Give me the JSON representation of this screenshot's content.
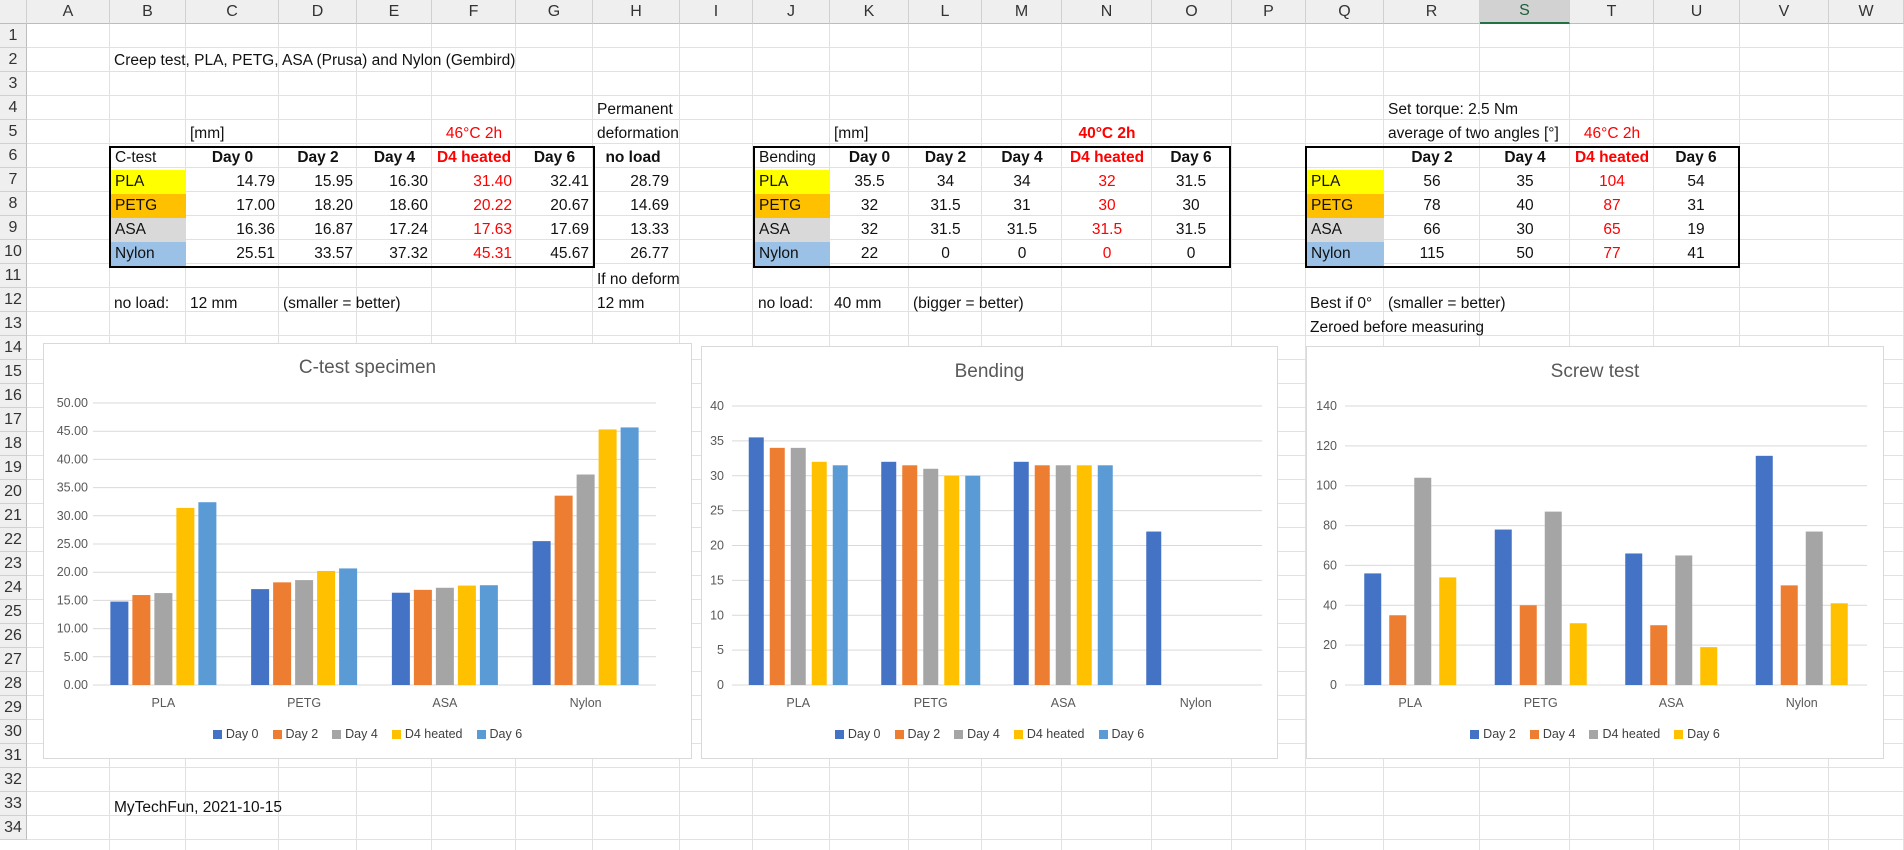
{
  "columns": [
    "A",
    "B",
    "C",
    "D",
    "E",
    "F",
    "G",
    "H",
    "I",
    "J",
    "K",
    "L",
    "M",
    "N",
    "O",
    "P",
    "Q",
    "R",
    "S",
    "T",
    "U",
    "V",
    "W"
  ],
  "rows": [
    "1",
    "2",
    "3",
    "4",
    "5",
    "6",
    "7",
    "8",
    "9",
    "10",
    "11",
    "12",
    "13",
    "14",
    "15",
    "16",
    "17",
    "18",
    "19",
    "20",
    "21",
    "22",
    "23",
    "24",
    "25",
    "26",
    "27",
    "28",
    "29",
    "30",
    "31",
    "32",
    "33",
    "34"
  ],
  "selected_column": "S",
  "sheet": {
    "title": "Creep test, PLA, PETG, ASA (Prusa) and Nylon (Gembird)",
    "footer": "MyTechFun, 2021-10-15",
    "ctest": {
      "unit": "[mm]",
      "heat_note": "46°C 2h",
      "perm_label_1": "Permanent",
      "perm_label_2": "deformation",
      "corner": "C-test",
      "headers": [
        "Day 0",
        "Day 2",
        "Day 4",
        "D4 heated",
        "Day 6",
        "no load"
      ],
      "rows": [
        {
          "name": "PLA",
          "values": [
            "14.79",
            "15.95",
            "16.30",
            "31.40",
            "32.41",
            "28.79"
          ]
        },
        {
          "name": "PETG",
          "values": [
            "17.00",
            "18.20",
            "18.60",
            "20.22",
            "20.67",
            "14.69"
          ]
        },
        {
          "name": "ASA",
          "values": [
            "16.36",
            "16.87",
            "17.24",
            "17.63",
            "17.69",
            "13.33"
          ]
        },
        {
          "name": "Nylon",
          "values": [
            "25.51",
            "33.57",
            "37.32",
            "45.31",
            "45.67",
            "26.77"
          ]
        }
      ],
      "noload_label": "no load:",
      "noload_value": "12 mm",
      "note": "(smaller = better)",
      "if_no_deform": "If no deform",
      "if_no_deform_value": "12 mm"
    },
    "bending": {
      "unit": "[mm]",
      "heat_note": "40°C 2h",
      "corner": "Bending",
      "headers": [
        "Day 0",
        "Day 2",
        "Day 4",
        "D4 heated",
        "Day 6"
      ],
      "rows": [
        {
          "name": "PLA",
          "values": [
            "35.5",
            "34",
            "34",
            "32",
            "31.5"
          ]
        },
        {
          "name": "PETG",
          "values": [
            "32",
            "31.5",
            "31",
            "30",
            "30"
          ]
        },
        {
          "name": "ASA",
          "values": [
            "32",
            "31.5",
            "31.5",
            "31.5",
            "31.5"
          ]
        },
        {
          "name": "Nylon",
          "values": [
            "22",
            "0",
            "0",
            "0",
            "0"
          ]
        }
      ],
      "noload_label": "no load:",
      "noload_value": "40 mm",
      "note": "(bigger = better)"
    },
    "screw": {
      "torque": "Set torque: 2.5 Nm",
      "avg_label": "average of two angles [°]",
      "heat_note": "46°C 2h",
      "headers": [
        "Day 2",
        "Day 4",
        "D4 heated",
        "Day 6"
      ],
      "rows": [
        {
          "name": "PLA",
          "values": [
            "56",
            "35",
            "104",
            "54"
          ]
        },
        {
          "name": "PETG",
          "values": [
            "78",
            "40",
            "87",
            "31"
          ]
        },
        {
          "name": "ASA",
          "values": [
            "66",
            "30",
            "65",
            "19"
          ]
        },
        {
          "name": "Nylon",
          "values": [
            "115",
            "50",
            "77",
            "41"
          ]
        }
      ],
      "best_label": "Best if 0°",
      "note": "(smaller = better)",
      "zeroed": "Zeroed before measuring"
    }
  },
  "colors": {
    "day0": "#4472c4",
    "day2": "#ed7d31",
    "day4": "#a5a5a5",
    "heated": "#ffc000",
    "day6": "#5b9bd5",
    "accent_red": "#ff0000"
  },
  "chart_data": [
    {
      "type": "bar",
      "title": "C-test specimen",
      "categories": [
        "PLA",
        "PETG",
        "ASA",
        "Nylon"
      ],
      "ylim": [
        0,
        50
      ],
      "ytick_step": 5,
      "ytick_decimals": 2,
      "ytick_labels": [
        "0.00",
        "5.00",
        "10.00",
        "15.00",
        "20.00",
        "25.00",
        "30.00",
        "35.00",
        "40.00",
        "45.00",
        "50.00"
      ],
      "grid": true,
      "legend": "bottom",
      "series": [
        {
          "name": "Day 0",
          "color": "#4472c4",
          "values": [
            14.79,
            17.0,
            16.36,
            25.51
          ]
        },
        {
          "name": "Day 2",
          "color": "#ed7d31",
          "values": [
            15.95,
            18.2,
            16.87,
            33.57
          ]
        },
        {
          "name": "Day 4",
          "color": "#a5a5a5",
          "values": [
            16.3,
            18.6,
            17.24,
            37.32
          ]
        },
        {
          "name": "D4 heated",
          "color": "#ffc000",
          "values": [
            31.4,
            20.22,
            17.63,
            45.31
          ]
        },
        {
          "name": "Day 6",
          "color": "#5b9bd5",
          "values": [
            32.41,
            20.67,
            17.69,
            45.67
          ]
        }
      ]
    },
    {
      "type": "bar",
      "title": "Bending",
      "categories": [
        "PLA",
        "PETG",
        "ASA",
        "Nylon"
      ],
      "ylim": [
        0,
        40
      ],
      "ytick_step": 5,
      "ytick_decimals": 0,
      "ytick_labels": [
        "0",
        "5",
        "10",
        "15",
        "20",
        "25",
        "30",
        "35",
        "40"
      ],
      "grid": true,
      "legend": "bottom",
      "series": [
        {
          "name": "Day 0",
          "color": "#4472c4",
          "values": [
            35.5,
            32,
            32,
            22
          ]
        },
        {
          "name": "Day 2",
          "color": "#ed7d31",
          "values": [
            34,
            31.5,
            31.5,
            0
          ]
        },
        {
          "name": "Day 4",
          "color": "#a5a5a5",
          "values": [
            34,
            31,
            31.5,
            0
          ]
        },
        {
          "name": "D4 heated",
          "color": "#ffc000",
          "values": [
            32,
            30,
            31.5,
            0
          ]
        },
        {
          "name": "Day 6",
          "color": "#5b9bd5",
          "values": [
            31.5,
            30,
            31.5,
            0
          ]
        }
      ]
    },
    {
      "type": "bar",
      "title": "Screw test",
      "categories": [
        "PLA",
        "PETG",
        "ASA",
        "Nylon"
      ],
      "ylim": [
        0,
        140
      ],
      "ytick_step": 20,
      "ytick_decimals": 0,
      "ytick_labels": [
        "0",
        "20",
        "40",
        "60",
        "80",
        "100",
        "120",
        "140"
      ],
      "grid": true,
      "legend": "bottom",
      "series": [
        {
          "name": "Day 2",
          "color": "#4472c4",
          "values": [
            56,
            78,
            66,
            115
          ]
        },
        {
          "name": "Day 4",
          "color": "#ed7d31",
          "values": [
            35,
            40,
            30,
            50
          ]
        },
        {
          "name": "D4 heated",
          "color": "#a5a5a5",
          "values": [
            104,
            87,
            65,
            77
          ]
        },
        {
          "name": "Day 6",
          "color": "#ffc000",
          "values": [
            54,
            31,
            19,
            41
          ]
        }
      ]
    }
  ]
}
